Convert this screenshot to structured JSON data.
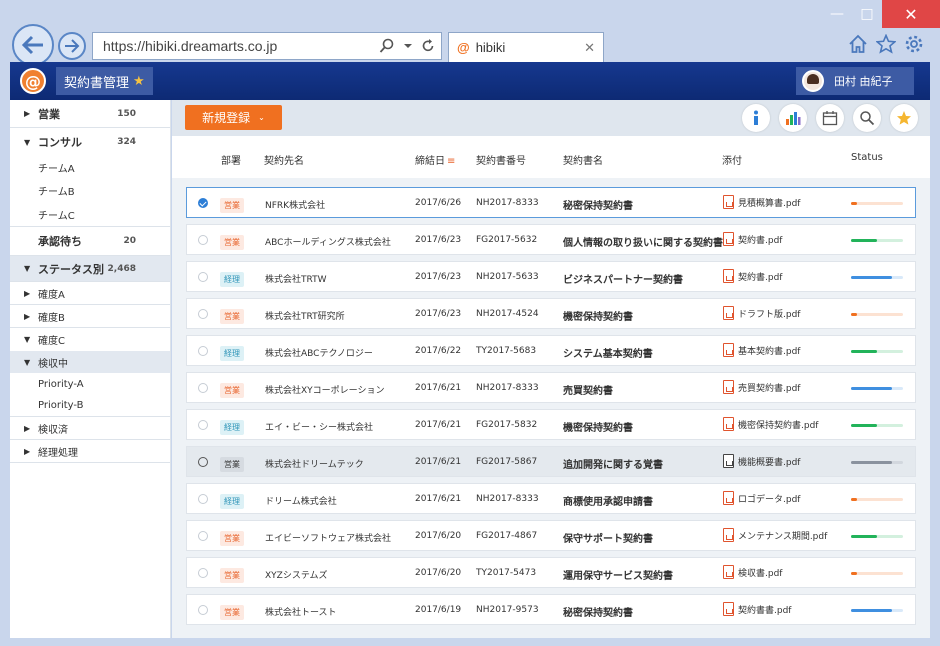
{
  "browser": {
    "url": "https://hibiki.dreamarts.co.jp",
    "tab_title": "hibiki",
    "tab_icon": "@"
  },
  "app": {
    "logo": "@",
    "name": "契約書管理",
    "user_name": "田村 由紀子"
  },
  "sidebar": {
    "items": [
      {
        "label": "営業",
        "count": "150",
        "caret": "right",
        "bold": true
      },
      {
        "label": "コンサル",
        "count": "324",
        "caret": "down",
        "bold": true
      },
      {
        "label": "チームA"
      },
      {
        "label": "チームB"
      },
      {
        "label": "チームC"
      },
      {
        "label": "承認待ち",
        "count": "20",
        "bold": true
      },
      {
        "label": "ステータス別",
        "count": "2,468",
        "caret": "down",
        "bold": true
      },
      {
        "label": "確度A",
        "caret": "right"
      },
      {
        "label": "確度B",
        "caret": "right"
      },
      {
        "label": "確度C",
        "caret": "down"
      },
      {
        "label": "検収中",
        "caret": "down"
      },
      {
        "label": "Priority-A"
      },
      {
        "label": "Priority-B"
      },
      {
        "label": "検収済",
        "caret": "right"
      },
      {
        "label": "経理処理",
        "caret": "right"
      }
    ]
  },
  "toolbar": {
    "new_label": "新規登録",
    "icons": [
      "info-icon",
      "chart-icon",
      "calendar-icon",
      "search-icon",
      "star-icon"
    ]
  },
  "table": {
    "headers": {
      "dept": "部署",
      "company": "契約先名",
      "date": "締結日",
      "number": "契約書番号",
      "title": "契約書名",
      "attachment": "添付",
      "status": "Status"
    },
    "rows": [
      {
        "dept": "営業",
        "company": "NFRK株式会社",
        "date": "2017/6/26",
        "number": "NH2017-8333",
        "title": "秘密保持契約書",
        "file": "見積概算書.pdf",
        "progress": 0.12,
        "color": "#f07020"
      },
      {
        "dept": "営業",
        "company": "ABCホールディングス株式会社",
        "date": "2017/6/23",
        "number": "FG2017-5632",
        "title": "個人情報の取り扱いに関する契約書",
        "file": "契約書.pdf",
        "progress": 0.5,
        "color": "#22b35a"
      },
      {
        "dept": "経理",
        "company": "株式会社TRTW",
        "date": "2017/6/23",
        "number": "NH2017-5633",
        "title": "ビジネスパートナー契約書",
        "file": "契約書.pdf",
        "progress": 0.78,
        "color": "#3f8fe0"
      },
      {
        "dept": "営業",
        "company": "株式会社TRT研究所",
        "date": "2017/6/23",
        "number": "NH2017-4524",
        "title": "機密保持契約書",
        "file": "ドラフト版.pdf",
        "progress": 0.12,
        "color": "#f07020"
      },
      {
        "dept": "経理",
        "company": "株式会社ABCテクノロジー",
        "date": "2017/6/22",
        "number": "TY2017-5683",
        "title": "システム基本契約書",
        "file": "基本契約書.pdf",
        "progress": 0.5,
        "color": "#22b35a"
      },
      {
        "dept": "営業",
        "company": "株式会社XYコーポレーション",
        "date": "2017/6/21",
        "number": "NH2017-8333",
        "title": "売買契約書",
        "file": "売買契約書.pdf",
        "progress": 0.78,
        "color": "#3f8fe0"
      },
      {
        "dept": "経理",
        "company": "エイ・ビー・シー株式会社",
        "date": "2017/6/21",
        "number": "FG2017-5832",
        "title": "機密保持契約書",
        "file": "機密保持契約書.pdf",
        "progress": 0.5,
        "color": "#22b35a"
      },
      {
        "dept": "営業",
        "company": "株式会社ドリームテック",
        "date": "2017/6/21",
        "number": "FG2017-5867",
        "title": "追加開発に関する覚書",
        "file": "機能概要書.pdf",
        "progress": 0.78,
        "color": "#8a929e"
      },
      {
        "dept": "経理",
        "company": "ドリーム株式会社",
        "date": "2017/6/21",
        "number": "NH2017-8333",
        "title": "商標使用承認申請書",
        "file": "ロゴデータ.pdf",
        "progress": 0.12,
        "color": "#f07020"
      },
      {
        "dept": "営業",
        "company": "エイビーソフトウェア株式会社",
        "date": "2017/6/20",
        "number": "FG2017-4867",
        "title": "保守サポート契約書",
        "file": "メンテナンス期間.pdf",
        "progress": 0.5,
        "color": "#22b35a"
      },
      {
        "dept": "営業",
        "company": "XYZシステムズ",
        "date": "2017/6/20",
        "number": "TY2017-5473",
        "title": "運用保守サービス契約書",
        "file": "検収書.pdf",
        "progress": 0.12,
        "color": "#f07020"
      },
      {
        "dept": "営業",
        "company": "株式会社トースト",
        "date": "2017/6/19",
        "number": "NH2017-9573",
        "title": "秘密保持契約書",
        "file": "契約書書.pdf",
        "progress": 0.78,
        "color": "#3f8fe0"
      }
    ]
  }
}
